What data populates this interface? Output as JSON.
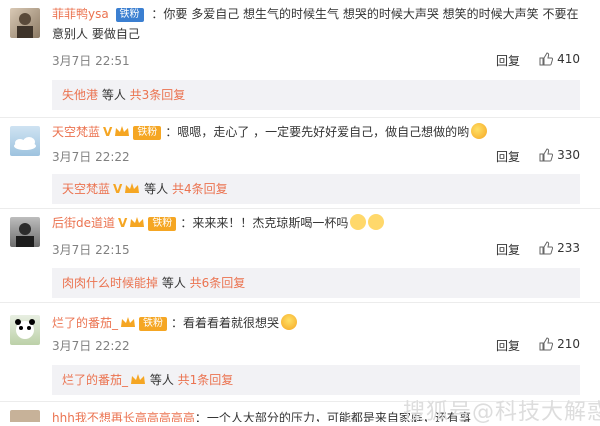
{
  "comments": [
    {
      "username": "菲菲鸭ysa",
      "badge": "铁粉",
      "text_line1": "：你要  多爱自己  想生气的时候生气  想哭的时候大声哭  想笑的时候大声笑  不要在",
      "text_line2": "意别人  要做自己",
      "time": "3月7日 22:51",
      "reply": "回复",
      "likes": "410",
      "sub": {
        "name": "失他港",
        "middle": " 等人 ",
        "count": "共3条回复"
      }
    },
    {
      "username": "天空梵蓝",
      "badge": "铁粉",
      "text": "：嗯嗯，走心了  ，一定要先好好爱自己，做自己想做的哟",
      "time": "3月7日 22:22",
      "reply": "回复",
      "likes": "330",
      "sub": {
        "name": "天空梵蓝",
        "middle": " 等人 ",
        "count": "共4条回复"
      }
    },
    {
      "username": "后街de道道",
      "badge": "铁粉",
      "text": "：来来来！！杰克琼斯喝一杯吗",
      "time": "3月7日 22:15",
      "reply": "回复",
      "likes": "233",
      "sub": {
        "name": "肉肉什么时候能掉",
        "middle": " 等人 ",
        "count": "共6条回复"
      }
    },
    {
      "username": "烂了的番茄_",
      "badge": "铁粉",
      "text": "：看着看着就很想哭",
      "time": "3月7日 22:22",
      "reply": "回复",
      "likes": "210",
      "sub": {
        "name": "烂了的番茄_",
        "middle": " 等人 ",
        "count": "共1条回复"
      }
    },
    {
      "username": "hhh我不想再长高高高高高",
      "text": "：一个人大部分的压力，可能都是来自家庭，还有事"
    }
  ],
  "watermark": "搜狐号@科技大解惑"
}
